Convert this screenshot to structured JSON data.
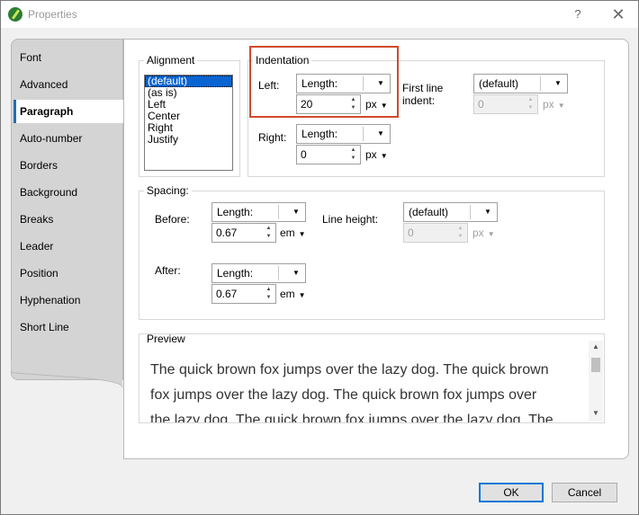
{
  "window": {
    "title": "Properties",
    "help_glyph": "?",
    "close_glyph": "✕"
  },
  "tabs": [
    {
      "label": "Font"
    },
    {
      "label": "Advanced"
    },
    {
      "label": "Paragraph",
      "active": true
    },
    {
      "label": "Auto-number"
    },
    {
      "label": "Borders"
    },
    {
      "label": "Background"
    },
    {
      "label": "Breaks"
    },
    {
      "label": "Leader"
    },
    {
      "label": "Position"
    },
    {
      "label": "Hyphenation"
    },
    {
      "label": "Short Line"
    }
  ],
  "alignment": {
    "label": "Alignment",
    "options": [
      "(default)",
      "(as is)",
      "Left",
      "Center",
      "Right",
      "Justify"
    ],
    "selected": "(default)"
  },
  "indentation": {
    "label": "Indentation",
    "left": {
      "label": "Left:",
      "mode": "Length:",
      "value": "20",
      "unit": "px"
    },
    "right": {
      "label": "Right:",
      "mode": "Length:",
      "value": "0",
      "unit": "px"
    },
    "first_line": {
      "label_line1": "First line",
      "label_line2": "indent:",
      "mode": "(default)",
      "value": "0",
      "unit": "px"
    }
  },
  "spacing": {
    "label": "Spacing:",
    "before": {
      "label": "Before:",
      "mode": "Length:",
      "value": "0.67",
      "unit": "em"
    },
    "after": {
      "label": "After:",
      "mode": "Length:",
      "value": "0.67",
      "unit": "em"
    },
    "line_height": {
      "label": "Line height:",
      "mode": "(default)",
      "value": "0",
      "unit": "px"
    }
  },
  "preview": {
    "label": "Preview",
    "lines": [
      "The quick brown fox jumps over the lazy dog. The quick brown",
      "fox jumps over the lazy dog. The quick brown fox jumps over",
      "the lazy dog. The quick brown fox jumps over the lazy dog. The"
    ]
  },
  "buttons": {
    "ok": "OK",
    "cancel": "Cancel"
  },
  "glyphs": {
    "dropdown": "▼",
    "spin_up": "▲",
    "spin_down": "▼",
    "scroll_up": "▲",
    "scroll_down": "▼"
  },
  "colors": {
    "highlight": "#d04a2a",
    "selection": "#0a64d2",
    "active_tab_accent": "#1e6fb8"
  }
}
